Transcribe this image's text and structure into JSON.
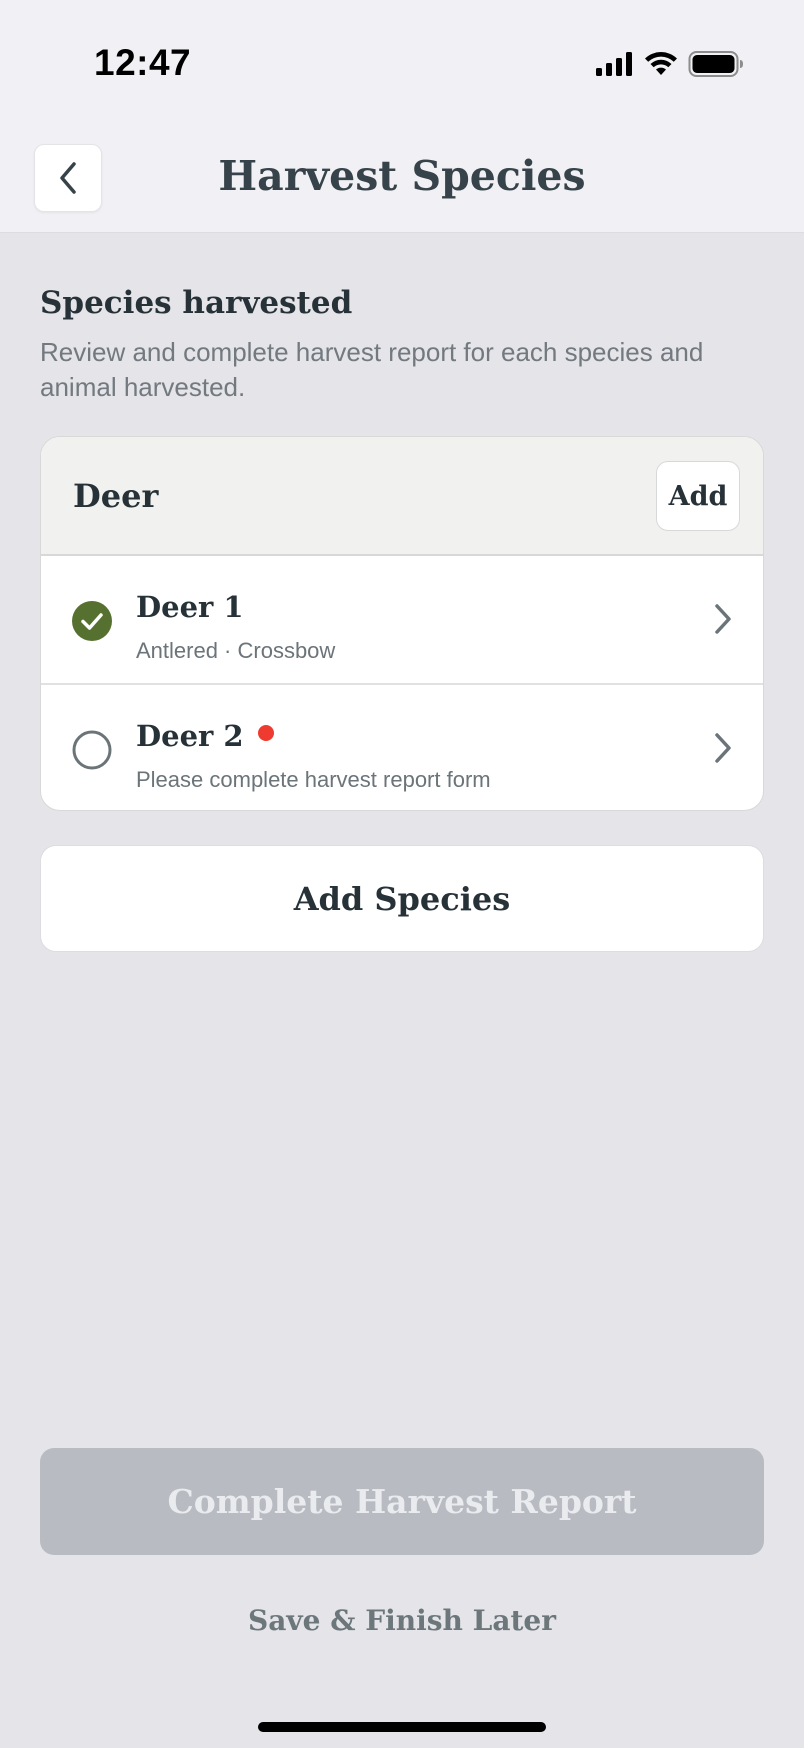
{
  "status_bar": {
    "time": "12:47",
    "icons": [
      "signal-icon",
      "wifi-icon",
      "battery-icon"
    ]
  },
  "header": {
    "back_icon": "chevron-left-icon",
    "title": "Harvest Species"
  },
  "section": {
    "title": "Species harvested",
    "description": "Review and complete harvest report for each species and animal harvested."
  },
  "species_card": {
    "title": "Deer",
    "add_label": "Add",
    "items": [
      {
        "title": "Deer 1",
        "subtitle": "Antlered · Crossbow",
        "status": "complete",
        "needs_attention": false
      },
      {
        "title": "Deer 2",
        "subtitle": "Please complete harvest report form",
        "status": "incomplete",
        "needs_attention": true
      }
    ]
  },
  "add_species_label": "Add Species",
  "footer": {
    "complete_label": "Complete Harvest Report",
    "complete_disabled": true,
    "save_later_label": "Save & Finish Later"
  },
  "colors": {
    "check_green": "#55702f",
    "alert_red": "#ef3b2f",
    "disabled_button": "#b8bcc2"
  }
}
